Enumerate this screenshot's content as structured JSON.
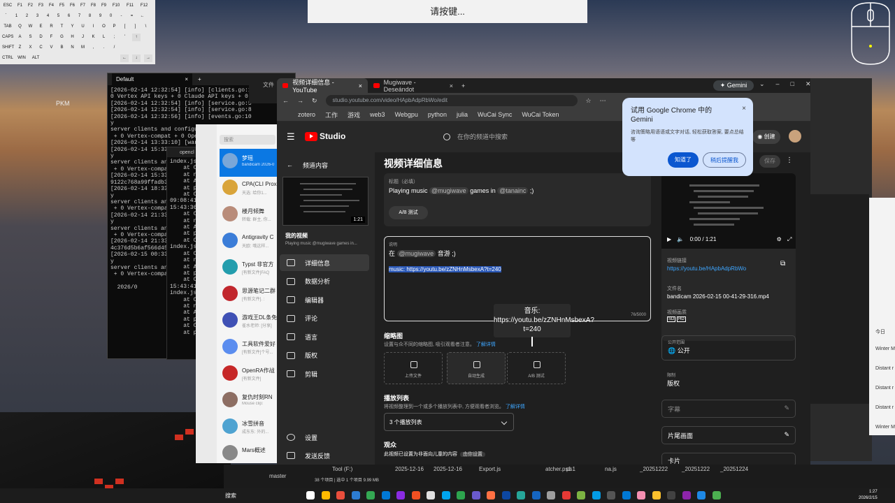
{
  "osk": {
    "rows": [
      [
        "ESC",
        "F1",
        "F2",
        "F3",
        "F4",
        "F5",
        "F6",
        "F7",
        "F8",
        "F9",
        "F10",
        "F11",
        "F12"
      ],
      [
        "`",
        "1",
        "2",
        "3",
        "4",
        "5",
        "6",
        "7",
        "8",
        "9",
        "0",
        "-",
        "=",
        "←"
      ],
      [
        "TAB",
        "Q",
        "W",
        "E",
        "R",
        "T",
        "Y",
        "U",
        "I",
        "O",
        "P",
        "[",
        "]",
        "\\"
      ],
      [
        "CAPS",
        "A",
        "S",
        "D",
        "F",
        "G",
        "H",
        "J",
        "K",
        "L",
        ";",
        "'"
      ],
      [
        "SHIFT",
        "Z",
        "X",
        "C",
        "V",
        "B",
        "N",
        "M",
        ",",
        ".",
        "/"
      ],
      [
        "CTRL",
        "WIN",
        "ALT"
      ]
    ],
    "arrows": [
      "↑",
      "←",
      "↓",
      "→"
    ]
  },
  "banner": "请按键...",
  "desktop_label": "PKM",
  "terminal": {
    "tab_title": "Default",
    "lines": [
      "[2026-02-14 12:32:54] [info] [clients.go:16",
      "0 Vertex API keys + 0 Claude API keys + 0 C",
      "[2026-02-14 12:32:54] [info] [service.go:5",
      "[2026-02-14 12:32:54] [info] [service.go:8",
      "[2026-02-14 12:32:56] [info] [events.go:10",
      "y",
      "server clients and configu",
      " + 0 Vertex-compat + 0 Ope",
      "[2026-02-14 13:33:10] [war",
      "[2026-02-14 15:33",
      "y",
      "server clients an",
      " + 0 Vertex-compa",
      "[2026-02-14 15:33",
      "9122c768a99ffadb3",
      "[2026-02-14 18:33",
      "y",
      "server clients an",
      " + 0 Vertex-compa",
      "[2026-02-14 21:33",
      "y",
      "server clients an",
      " + 0 Vertex-compa",
      "[2026-02-14 21:33",
      "4c376d5b6af566d45",
      "[2026-02-15 00:33",
      "y",
      "server clients an",
      " + 0 Vertex-compa",
      "",
      "  2026/0"
    ]
  },
  "terminal2": {
    "tab_title": "opencl",
    "lines": [
      "index.js",
      "    at C",
      "    at n",
      "    at A",
      "    at p",
      "    at C",
      "09:08:41",
      "15:43:36",
      "    at C",
      "    at n",
      "    at A",
      "    at p",
      "    at C",
      "index.js",
      "    at C",
      "    at n",
      "    at A",
      "    at p",
      "    at C",
      "15:43:41",
      "index.js",
      "    at C",
      "    at n",
      "    at A",
      "    at p",
      "    at C",
      "    at p"
    ]
  },
  "vscode_behind": {
    "label": "文件"
  },
  "qq": {
    "search_placeholder": "搜索",
    "items": [
      {
        "name": "梦瑶",
        "msg": "bandicam 2026-0",
        "color": "#7aa7d8",
        "selected": true
      },
      {
        "name": "CPA(CLI Prox",
        "msg": "天选: 给你1...",
        "color": "#d9a43a"
      },
      {
        "name": "楼月倾舞",
        "msg": "转载: 群主, 你...",
        "color": "#b98c7a"
      },
      {
        "name": "Antigravity C",
        "msg": "天欧: 哦这样...",
        "color": "#3b7dd8"
      },
      {
        "name": "Typst 非官方",
        "msg": "[有新文件]FAQ",
        "color": "#239dad"
      },
      {
        "name": "思源笔记二群",
        "msg": "[有新文件]. :",
        "color": "#c1272d"
      },
      {
        "name": "游戏王DL条免",
        "msg": "雀水老师: [分享]",
        "color": "#3f51b5"
      },
      {
        "name": "工具软件爱好",
        "msg": "[有新文件]个号...",
        "color": "#5b8def"
      },
      {
        "name": "OpenRA作战",
        "msg": "[有新文件]",
        "color": "#c62828"
      },
      {
        "name": "复仇时刻RN",
        "msg": "Mouse clip:",
        "color": "#8d6e63"
      },
      {
        "name": "冰雪拼音",
        "msg": "成东东: 外的...",
        "color": "#4fa3d1"
      },
      {
        "name": "Mars概述",
        "msg": "",
        "color": "#888888"
      }
    ]
  },
  "chrome": {
    "tabs": [
      {
        "label": "视频详细信息 - YouTube",
        "active": true
      },
      {
        "label": "Mugiwave - Deseándot",
        "active": false
      }
    ],
    "gemini_button": "Gemini",
    "url": "studio.youtube.com/video/HApbAdpRbWo/edit",
    "bookmarks": [
      "zotero",
      "工作",
      "游戏",
      "web3",
      "Webgpu",
      "python",
      "julia",
      "WuCai Sync",
      "WuCai Token",
      "所有书签"
    ]
  },
  "gemini_popup": {
    "title": "试用 Google Chrome 中的 Gemini",
    "body": "咨询策略用语语或文字对话, 轻松获取答案, 要点总结等",
    "ok": "知道了",
    "later": "稍后提醒我"
  },
  "studio": {
    "logo": "Studio",
    "search_placeholder": "在你的频道中搜索",
    "create": "创建",
    "back_label": "频道内容",
    "thumb_duration": "1:21",
    "my_video_label": "我的视频",
    "my_video_title": "Playing music @mugiwave games in...",
    "nav": [
      {
        "label": "详细信息",
        "active": true
      },
      {
        "label": "数据分析"
      },
      {
        "label": "编辑器"
      },
      {
        "label": "评论"
      },
      {
        "label": "语言"
      },
      {
        "label": "版权"
      },
      {
        "label": "剪辑"
      }
    ],
    "settings": "设置",
    "feedback": "发送反馈",
    "page_title": "视频详细信息",
    "save": "保存",
    "title_label": "标题（必填）",
    "title_pre": "Playing music ",
    "title_m1": "@mugiwave",
    "title_mid": " games in ",
    "title_m2": "@tanainc",
    "title_post": " ;)",
    "ab_test": "A/B 测试",
    "desc_label": "说明",
    "desc_line1_a": "在",
    "desc_line1_m": "@mugiwave",
    "desc_line1_b": "音游 ;)",
    "desc_line2": "music: https://youtu.be/zZNHnMsbexA?t=240",
    "desc_count": "76/5000",
    "tooltip": "音乐: https://youtu.be/zZNHnMsbexA?t=240",
    "thumb_heading": "缩略图",
    "thumb_sub": "设置与众不同的缩略图, 吸引观看者注意。",
    "thumb_learn": "了解详情",
    "thumb_cards": [
      "上传文件",
      "自动生成",
      "A/B 测试"
    ],
    "playlist_heading": "播放列表",
    "playlist_sub": "将视频整理到一个或多个播放列表中, 方便观看者浏览。",
    "playlist_learn": "了解详情",
    "playlist_value": "3 个播放列表",
    "audience_heading": "观众",
    "audience_sub": "此视频已设置为非面向儿童的内容",
    "audience_chip": "由你设置",
    "video_time": "0:00 / 1:21",
    "video_link_label": "视频链接",
    "video_link": "https://youtu.be/HApbAdpRbWo",
    "filename_label": "文件名",
    "filename": "bandicam 2026-02-15 00-41-29-316.mp4",
    "quality_label": "视频画质",
    "visibility_label": "公开范围",
    "visibility": "公开",
    "restrictions_label": "限制",
    "restrictions": "版权",
    "subtitles": "字幕",
    "end_screen": "片尾画面",
    "cards": "卡片"
  },
  "right_app": {
    "items": [
      "今日",
      "Winter M",
      "Distant r",
      "Distant r",
      "Distant r",
      "Winter M"
    ]
  },
  "explorer": {
    "status": "38 个项目  |  选中 1 个项目  9.99 MB",
    "drive": "Tool (F:)",
    "branch": "master",
    "cols": [
      "2025-12-16",
      "2025-12-16",
      "Export.js",
      "atcher.ps1",
      "ps1",
      "na.js",
      "_20251222",
      "_20251222",
      "_20251224"
    ]
  },
  "taskbar": {
    "search": "搜索",
    "time": "1:27",
    "date": "2026/2/15"
  },
  "colors": {
    "yt_red": "#ff0000",
    "link_blue": "#3ea6ff",
    "chrome_accent": "#0b57d0",
    "selection": "#2b59b8"
  }
}
